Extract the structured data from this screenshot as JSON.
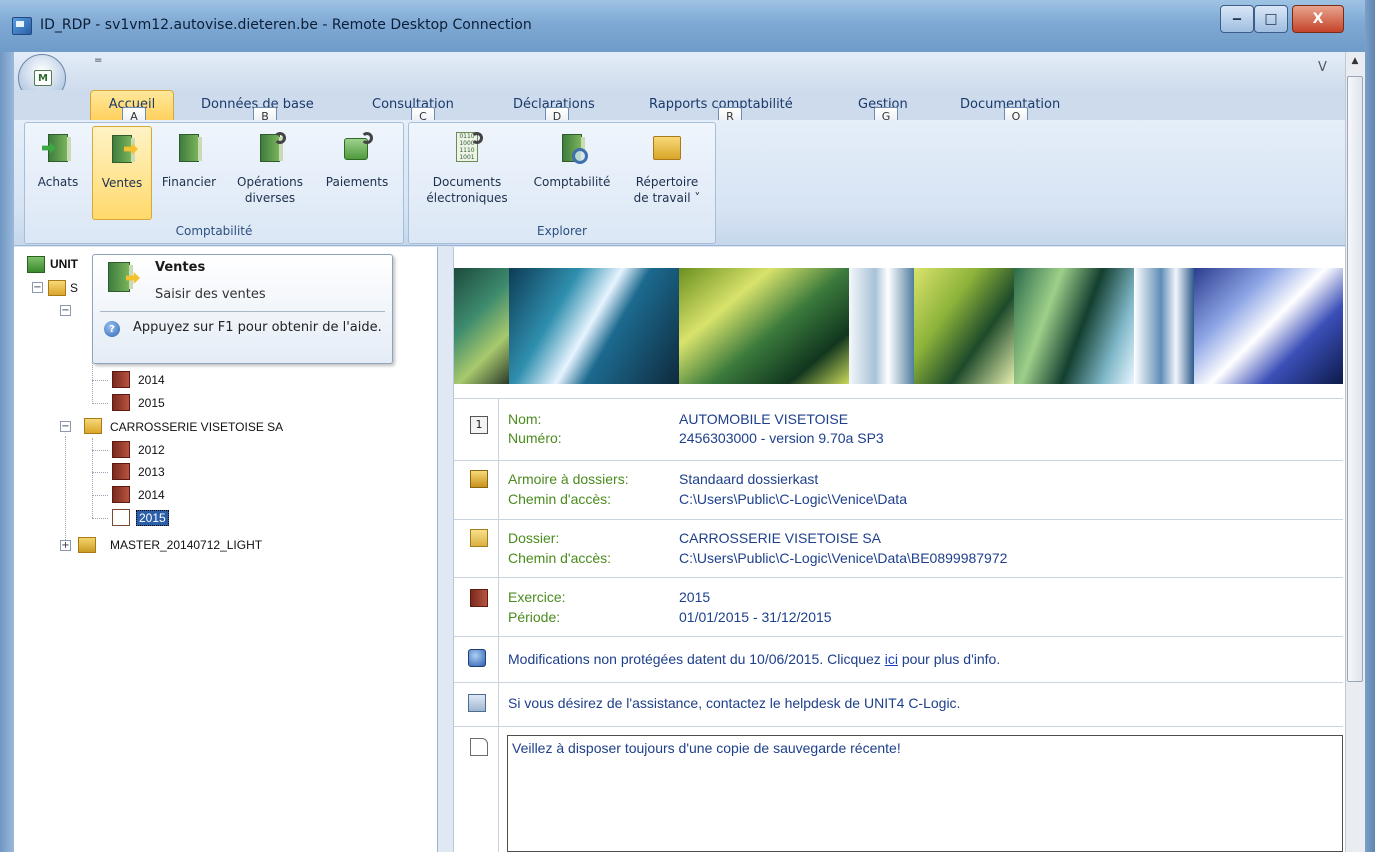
{
  "window": {
    "title": "ID_RDP - sv1vm12.autovise.dieteren.be - Remote Desktop Connection",
    "minimize": "‒",
    "maximize": "□",
    "close": "X"
  },
  "app": {
    "orb_letter": "M",
    "qat_glyph": "=",
    "top_right_text": "V"
  },
  "ribbon": {
    "tabs": [
      {
        "label": "Accueil",
        "keytip": "A"
      },
      {
        "label": "Données de base",
        "keytip": "B"
      },
      {
        "label": "Consultation",
        "keytip": "C"
      },
      {
        "label": "Déclarations",
        "keytip": "D"
      },
      {
        "label": "Rapports comptabilité",
        "keytip": "R"
      },
      {
        "label": "Gestion",
        "keytip": "G"
      },
      {
        "label": "Documentation",
        "keytip": "O"
      }
    ],
    "groups": [
      {
        "label": "Comptabilité",
        "buttons": [
          {
            "label": "Achats",
            "icon": "purchase-book-icon"
          },
          {
            "label": "Ventes",
            "icon": "sales-book-icon"
          },
          {
            "label": "Financier",
            "icon": "financial-book-icon"
          },
          {
            "label": "Opérations",
            "label2": "diverses",
            "icon": "misc-operations-icon"
          },
          {
            "label": "Paiements",
            "icon": "payments-icon"
          }
        ]
      },
      {
        "label": "Explorer",
        "buttons": [
          {
            "label": "Documents",
            "label2": "électroniques",
            "icon": "electronic-documents-icon"
          },
          {
            "label": "Comptabilité",
            "icon": "accounting-explorer-icon"
          },
          {
            "label": "Répertoire",
            "label2": "de travail ˅",
            "icon": "working-folder-icon"
          }
        ]
      }
    ]
  },
  "tooltip": {
    "title": "Ventes",
    "description": "Saisir des ventes",
    "help": "Appuyez sur F1 pour obtenir de l'aide.",
    "help_glyph": "?"
  },
  "tree": {
    "root_label": "UNIT",
    "root_child_label": "S",
    "items": [
      {
        "label": "2014"
      },
      {
        "label": "2015"
      },
      {
        "label": "CARROSSERIE VISETOISE SA"
      },
      {
        "label": "2012"
      },
      {
        "label": "2013"
      },
      {
        "label": "2014"
      },
      {
        "label": "2015",
        "selected": true
      },
      {
        "label": "MASTER_20140712_LIGHT"
      }
    ],
    "expand_minus": "−",
    "expand_plus": "+"
  },
  "info": {
    "nom_label": "Nom:",
    "nom_value": "AUTOMOBILE VISETOISE",
    "numero_label": "Numéro:",
    "numero_value": "2456303000 - version 9.70a SP3",
    "armoire_label": "Armoire à dossiers:",
    "armoire_value": "Standaard dossierkast",
    "chemin1_label": "Chemin d'accès:",
    "chemin1_value": "C:\\Users\\Public\\C-Logic\\Venice\\Data",
    "dossier_label": "Dossier:",
    "dossier_value": "CARROSSERIE VISETOISE SA",
    "chemin2_label": "Chemin d'accès:",
    "chemin2_value": "C:\\Users\\Public\\C-Logic\\Venice\\Data\\BE0899987972",
    "exercice_label": "Exercice:",
    "exercice_value": "2015",
    "periode_label": "Période:",
    "periode_value": "01/01/2015 - 31/12/2015",
    "modif_pre": "Modifications non protégées datent du 10/06/2015. Clicquez ",
    "modif_link": "ici",
    "modif_post": " pour plus d'info.",
    "assistance": "Si vous désirez de l'assistance, contactez le helpdesk de UNIT4 C-Logic.",
    "note": "Veillez à disposer toujours d'une copie de sauvegarde récente!"
  },
  "scrollbar": {
    "up_glyph": "▲"
  },
  "colors": {
    "label_green": "#4b8b1e",
    "value_blue": "#1d3f8c",
    "active_tab": "#ffd96b"
  }
}
